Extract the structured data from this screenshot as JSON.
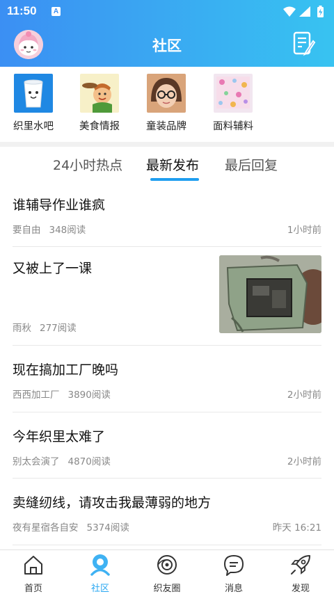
{
  "status_bar": {
    "time": "11:50",
    "notification_icon": "A"
  },
  "header": {
    "title": "社区",
    "avatar_icon": "cartoon-girl-avatar",
    "edit_icon": "edit-note-icon"
  },
  "categories": [
    {
      "label": "织里水吧",
      "icon": "cup-mascot"
    },
    {
      "label": "美食情报",
      "icon": "chef-cartoon"
    },
    {
      "label": "童装品牌",
      "icon": "child-photo"
    },
    {
      "label": "面料辅料",
      "icon": "fabric-swatch"
    }
  ],
  "tabs": [
    {
      "label": "24小时热点",
      "active": false
    },
    {
      "label": "最新发布",
      "active": true
    },
    {
      "label": "最后回复",
      "active": false
    }
  ],
  "posts": [
    {
      "title": "谁辅导作业谁疯",
      "author": "要自由",
      "reads": "348阅读",
      "time": "1小时前",
      "has_image": false
    },
    {
      "title": "又被上了一课",
      "author": "雨秋",
      "reads": "277阅读",
      "time": "",
      "has_image": true
    },
    {
      "title": "现在搞加工厂晚吗",
      "author": "西西加工厂",
      "reads": "3890阅读",
      "time": "2小时前",
      "has_image": false
    },
    {
      "title": "今年织里太难了",
      "author": "别太会演了",
      "reads": "4870阅读",
      "time": "2小时前",
      "has_image": false
    },
    {
      "title": "卖缝纫线，请攻击我最薄弱的地方",
      "author": "夜有星宿各自安",
      "reads": "5374阅读",
      "time": "昨天 16:21",
      "has_image": false
    }
  ],
  "tabbar": [
    {
      "label": "首页",
      "icon": "home-icon",
      "active": false
    },
    {
      "label": "社区",
      "icon": "community-icon",
      "active": true
    },
    {
      "label": "织友圈",
      "icon": "friends-circle-icon",
      "active": false
    },
    {
      "label": "消息",
      "icon": "message-icon",
      "active": false
    },
    {
      "label": "发现",
      "icon": "rocket-icon",
      "active": false
    }
  ],
  "colors": {
    "header_start": "#3b8ff3",
    "header_end": "#38c3f1",
    "accent": "#1f9ef0",
    "active_tab_label": "#27a7f2"
  }
}
